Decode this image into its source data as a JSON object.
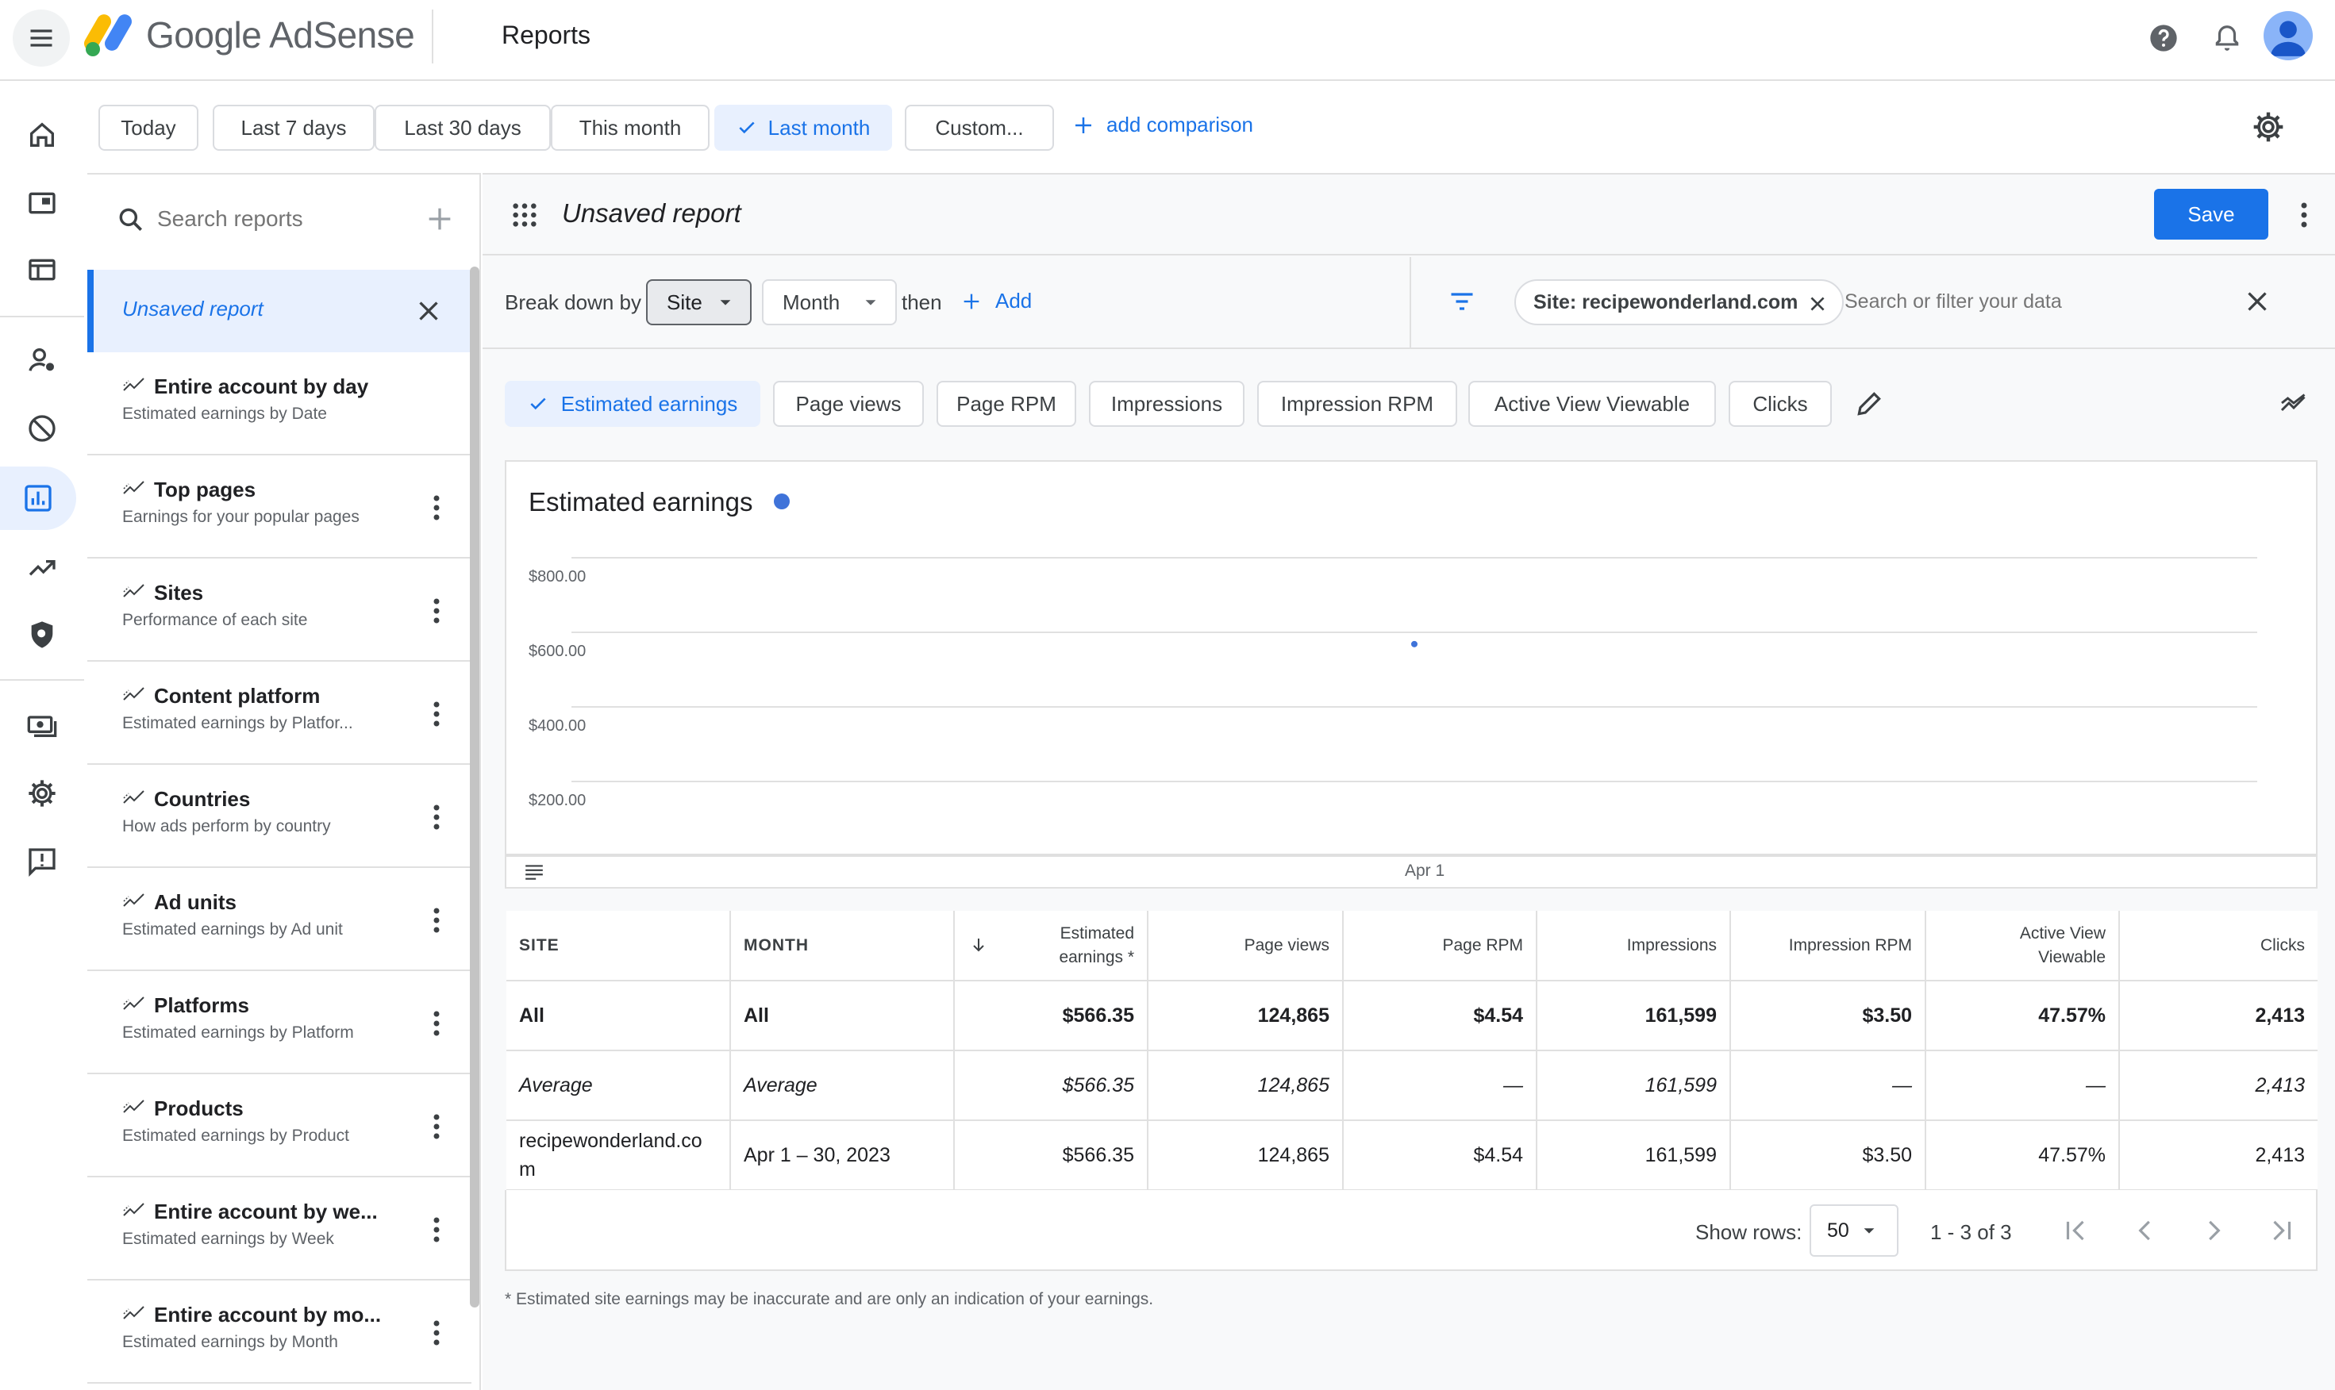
{
  "app": {
    "brand": "Google AdSense",
    "page_title": "Reports",
    "accent": "#1a73e8"
  },
  "date_range": {
    "chips": [
      "Today",
      "Last 7 days",
      "Last 30 days",
      "This month",
      "Last month",
      "Custom..."
    ],
    "selected": "Last month",
    "add_comparison": "add comparison"
  },
  "sidebar": {
    "search_placeholder": "Search reports",
    "current": "Unsaved report",
    "items": [
      {
        "title": "Entire account by day",
        "subtitle": "Estimated earnings by Date"
      },
      {
        "title": "Top pages",
        "subtitle": "Earnings for your popular pages"
      },
      {
        "title": "Sites",
        "subtitle": "Performance of each site"
      },
      {
        "title": "Content platform",
        "subtitle": "Estimated earnings by Platfor..."
      },
      {
        "title": "Countries",
        "subtitle": "How ads perform by country"
      },
      {
        "title": "Ad units",
        "subtitle": "Estimated earnings by Ad unit"
      },
      {
        "title": "Platforms",
        "subtitle": "Estimated earnings by Platform"
      },
      {
        "title": "Products",
        "subtitle": "Estimated earnings by Product"
      },
      {
        "title": "Entire account by we...",
        "subtitle": "Estimated earnings by Week"
      },
      {
        "title": "Entire account by mo...",
        "subtitle": "Estimated earnings by Month"
      }
    ]
  },
  "report": {
    "title": "Unsaved report",
    "save_label": "Save",
    "breakdown_label": "Break down by",
    "breakdown_primary": "Site",
    "breakdown_secondary": "Month",
    "then_label": "then",
    "add_label": "Add",
    "filter_chip": "Site: recipewonderland.com",
    "filter_placeholder": "Search or filter your data",
    "metrics": [
      "Estimated earnings",
      "Page views",
      "Page RPM",
      "Impressions",
      "Impression RPM",
      "Active View Viewable",
      "Clicks"
    ],
    "selected_metric": "Estimated earnings"
  },
  "chart_data": {
    "type": "scatter",
    "title": "Estimated earnings",
    "series_color": "#3f73d9",
    "y_ticks": [
      "$800.00",
      "$600.00",
      "$400.00",
      "$200.00"
    ],
    "ylim": [
      200,
      800
    ],
    "x_ticks": [
      "Apr 1"
    ],
    "points": [
      {
        "x": "Apr 1",
        "y": 566.35
      }
    ]
  },
  "table": {
    "columns": [
      "SITE",
      "MONTH",
      "Estimated earnings *",
      "Page views",
      "Page RPM",
      "Impressions",
      "Impression RPM",
      "Active View Viewable",
      "Clicks"
    ],
    "rows": [
      [
        "All",
        "All",
        "$566.35",
        "124,865",
        "$4.54",
        "161,599",
        "$3.50",
        "47.57%",
        "2,413"
      ],
      [
        "Average",
        "Average",
        "$566.35",
        "124,865",
        "—",
        "161,599",
        "—",
        "—",
        "2,413"
      ],
      [
        "recipewonderland.com",
        "Apr 1 – 30, 2023",
        "$566.35",
        "124,865",
        "$4.54",
        "161,599",
        "$3.50",
        "47.57%",
        "2,413"
      ]
    ],
    "show_rows_label": "Show rows:",
    "rows_per_page": "50",
    "range_text": "1 - 3 of 3"
  },
  "footnote": "* Estimated site earnings may be inaccurate and are only an indication of your earnings."
}
